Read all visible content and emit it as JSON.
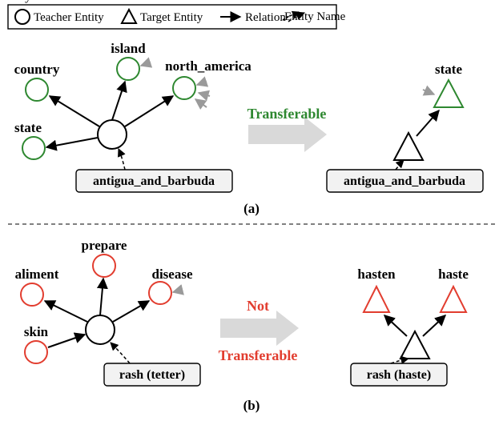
{
  "legend": {
    "teacher_entity": "Teacher Entity",
    "target_entity": "Target Entity",
    "relation": "Relation",
    "entity_name": "Entity Name"
  },
  "panel_a": {
    "label": "(a)",
    "status_label": "Transferable",
    "status_color": "#2e8830",
    "teacher_nodes": [
      "country",
      "state",
      "island",
      "north_america"
    ],
    "center_entity": "antigua_and_barbuda",
    "target_center_entity": "antigua_and_barbuda",
    "target_node": "state"
  },
  "panel_b": {
    "label": "(b)",
    "status_label1": "Not",
    "status_label2": "Transferable",
    "status_color": "#e23d2f",
    "teacher_nodes": [
      "aliment",
      "skin",
      "prepare",
      "disease"
    ],
    "center_entity": "rash (tetter)",
    "target_center_entity": "rash (haste)",
    "target_nodes": [
      "hasten",
      "haste"
    ]
  },
  "icons": {
    "teacher_entity": "circle-icon",
    "target_entity": "triangle-icon",
    "relation": "arrow-icon",
    "entity_name": "name-pointer-icon"
  }
}
